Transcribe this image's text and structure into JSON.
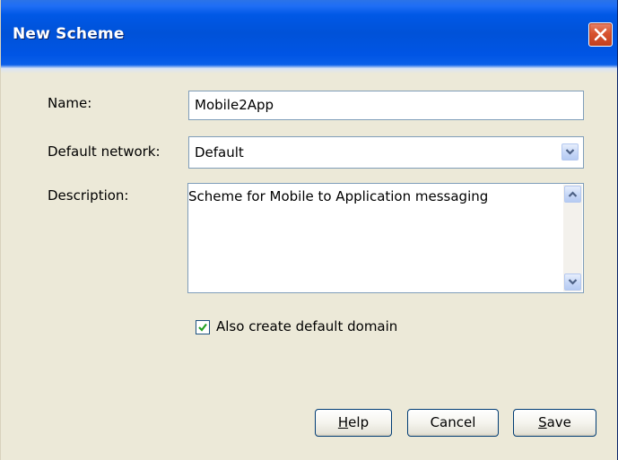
{
  "window": {
    "title": "New Scheme"
  },
  "form": {
    "name_label": "Name:",
    "name_value": "Mobile2App",
    "network_label": "Default network:",
    "network_value": "Default",
    "description_label": "Description:",
    "description_value": "Scheme for Mobile to Application messaging",
    "default_domain_label": "Also create default domain",
    "default_domain_checked": true
  },
  "buttons": {
    "help_mnemonic": "H",
    "help_rest": "elp",
    "cancel_label": "Cancel",
    "save_mnemonic": "S",
    "save_rest": "ave"
  },
  "icons": {
    "close": "close-icon",
    "dropdown": "chevron-down-icon",
    "scroll_up": "chevron-up-icon",
    "scroll_down": "chevron-down-icon",
    "check": "checkmark-icon"
  },
  "colors": {
    "titlebar": "#0058e6",
    "dialog_background": "#ece9d8",
    "field_border": "#7f9db9",
    "close_button": "#d8532e",
    "checkmark": "#21a121"
  }
}
